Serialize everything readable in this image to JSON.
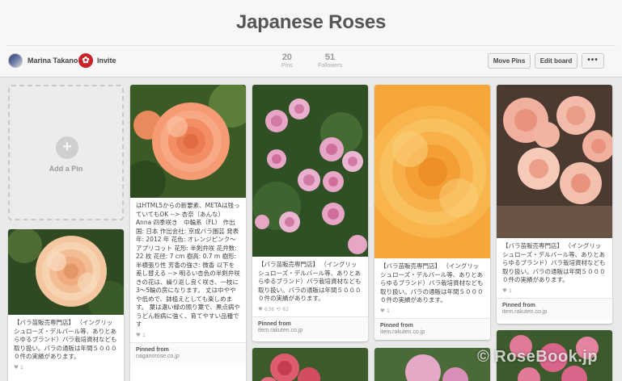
{
  "board": {
    "title": "Japanese Roses"
  },
  "owner": {
    "name": "Marina Takano",
    "avatar_icon": "user-avatar"
  },
  "invite": {
    "label": "Invite",
    "icon": "invite-avatar-icon"
  },
  "stats": {
    "pins": {
      "count": "20",
      "label": "Pins"
    },
    "followers": {
      "count": "51",
      "label": "Followers"
    }
  },
  "toolbar": {
    "move_pins": "Move Pins",
    "edit_board": "Edit board",
    "more": "•••"
  },
  "add_pin": {
    "label": "Add a Pin",
    "icon": "plus-icon"
  },
  "pins": [
    {
      "id": "p1",
      "description": "【バラ苗販売専門店】 （イングリッシュローズ・デルバール等、ありとあらゆるブランド）バラ栽培資材なども取り扱い。バラの通販は年間５００００件の実績があります。",
      "stats": "♥ 1",
      "pinned_from_label": "",
      "source": ""
    },
    {
      "id": "p2",
      "description": "はHTML5からの新要素、METAは残っていてもOK --> 杏奈（あんな） Anna 四季咲き　中輪系（FL） 作出国: 日本 作出会社: 京成バラ園芸 発表年: 2012 年 花色: オレンジピンク〜アプリコット 花形: 半剣弁咲 花弁数: 22 枚 花径: 7 cm 樹高: 0.7 m 樹形: 半横張り性 芳香の強さ: 微香 以下を差し替える --> 明るい杏色の半剣弁咲きの花は、繰り返し良く咲き、一枝に3～5輪の房になります。 丈は中ややや低めで、鉢植えとしても楽しめます。 葉は濃い緑の照り葉で、黒点病やうどん粉病に強く、育てやすい品種です",
      "stats": "♥ 1",
      "pinned_from_label": "Pinned from",
      "source": "naganorose.co.jp"
    },
    {
      "id": "p3",
      "description": "【バラ苗販売専門店】 （イングリッシュローズ・デルバール等、ありとあらゆるブランド）バラ栽培資材なども取り扱い。バラの通販は年間５００００件の実績があります。",
      "stats": "♥ 636  ⟲ 82",
      "pinned_from_label": "Pinned from",
      "source": "item.rakuten.co.jp"
    },
    {
      "id": "p4",
      "description": "【バラ苗販売専門店】 （イングリッシュローズ・デルバール等、ありとあらゆるブランド）バラ栽培資材なども取り扱い。バラの通販は年間５００００件の実績があります。",
      "stats": "♥ 1",
      "pinned_from_label": "Pinned from",
      "source": "item.rakuten.co.jp"
    },
    {
      "id": "p5",
      "description": "【バラ苗販売専門店】 （イングリッシュローズ・デルバール等、ありとあらゆるブランド）バラ栽培資材なども取り扱い。バラの通販は年間５００００件の実績があります。",
      "stats": "♥ 1",
      "pinned_from_label": "Pinned from",
      "source": "item.rakuten.co.jp"
    }
  ],
  "watermark": "© RoseBook.jp",
  "colors": {
    "accent": "#cb2027",
    "background": "#e9e9e9",
    "title": "#555555"
  }
}
